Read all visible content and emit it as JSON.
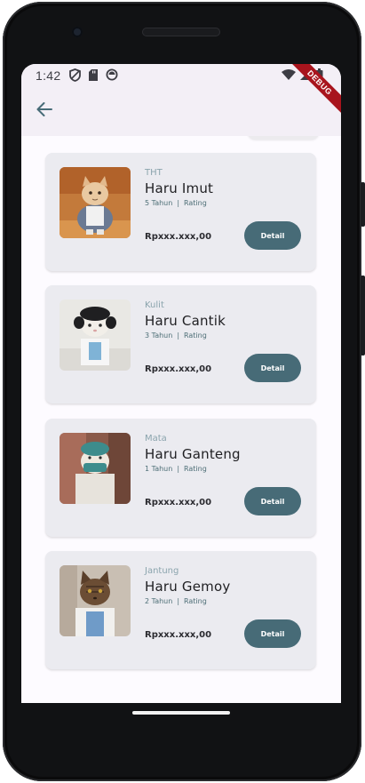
{
  "status_bar": {
    "time": "1:42",
    "left_icons": [
      "shield-icon",
      "sd-card-icon",
      "sync-icon"
    ],
    "right_icons": [
      "wifi-icon",
      "signal-icon",
      "battery-icon"
    ]
  },
  "debug_banner": "DEBUG",
  "appbar": {
    "back_icon": "arrow-back-icon"
  },
  "colors": {
    "accent": "#476b77",
    "category_text": "#8ba4ad",
    "card_bg": "#ebebf0",
    "appbar_bg": "#f3eff6"
  },
  "doctors": [
    {
      "category": "THT",
      "name": "Haru Imut",
      "years": "5 Tahun",
      "separator": "|",
      "rating_label": "Rating",
      "price": "Rpxxx.xxx,00",
      "detail_label": "Detail"
    },
    {
      "category": "Kulit",
      "name": "Haru Cantik",
      "years": "3 Tahun",
      "separator": "|",
      "rating_label": "Rating",
      "price": "Rpxxx.xxx,00",
      "detail_label": "Detail"
    },
    {
      "category": "Mata",
      "name": "Haru Ganteng",
      "years": "1 Tahun",
      "separator": "|",
      "rating_label": "Rating",
      "price": "Rpxxx.xxx,00",
      "detail_label": "Detail"
    },
    {
      "category": "Jantung",
      "name": "Haru Gemoy",
      "years": "2 Tahun",
      "separator": "|",
      "rating_label": "Rating",
      "price": "Rpxxx.xxx,00",
      "detail_label": "Detail"
    }
  ]
}
